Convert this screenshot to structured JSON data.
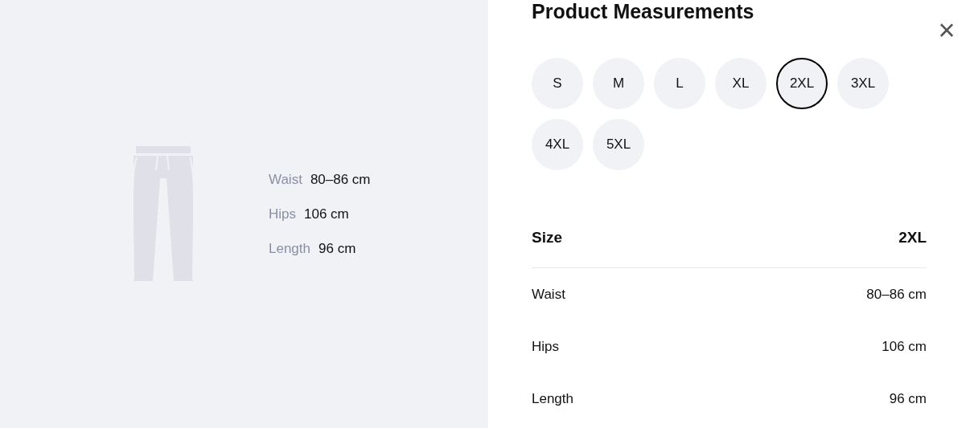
{
  "preview": {
    "measurements": [
      {
        "label": "Waist",
        "value": "80–86 cm"
      },
      {
        "label": "Hips",
        "value": "106 cm"
      },
      {
        "label": "Length",
        "value": "96 cm"
      }
    ]
  },
  "panel": {
    "title": "Product Measurements",
    "close": "×",
    "sizes": [
      {
        "label": "S",
        "selected": false
      },
      {
        "label": "M",
        "selected": false
      },
      {
        "label": "L",
        "selected": false
      },
      {
        "label": "XL",
        "selected": false
      },
      {
        "label": "2XL",
        "selected": true
      },
      {
        "label": "3XL",
        "selected": false
      },
      {
        "label": "4XL",
        "selected": false
      },
      {
        "label": "5XL",
        "selected": false
      }
    ],
    "table": {
      "header": {
        "label": "Size",
        "value": "2XL"
      },
      "rows": [
        {
          "label": "Waist",
          "value": "80–86 cm"
        },
        {
          "label": "Hips",
          "value": "106 cm"
        },
        {
          "label": "Length",
          "value": "96 cm"
        }
      ]
    }
  }
}
